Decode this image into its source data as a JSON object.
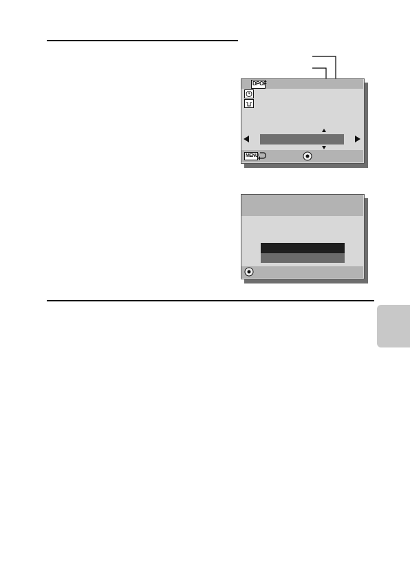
{
  "screen1": {
    "icons": [
      "dpof-icon",
      "clock-icon",
      "print-tray-icon",
      "menu-icon",
      "return-arrow-icon",
      "joystick-icon"
    ],
    "menu_label": "MENU",
    "dpof_label": "DPOF"
  },
  "screen2": {
    "icons": [
      "joystick-icon"
    ]
  },
  "colors": {
    "lcd_bg": "#d8d8d8",
    "band": "#b3b3b3",
    "dark_bar": "#1e1e1e",
    "mid_bar": "#6a6a6a",
    "side_tab": "#c8c8c8"
  }
}
